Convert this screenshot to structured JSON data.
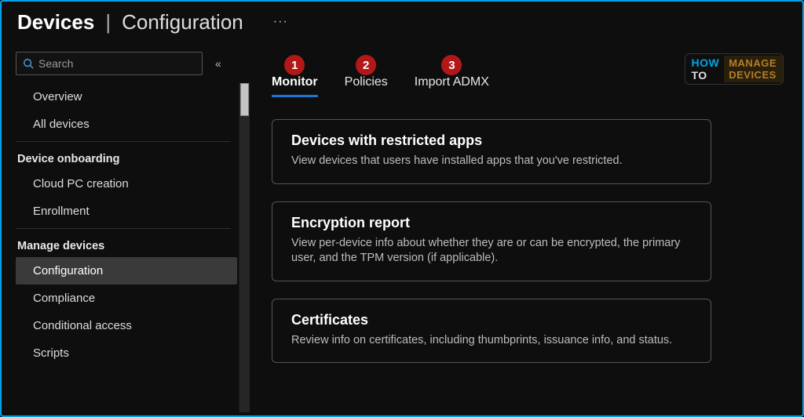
{
  "header": {
    "title_strong": "Devices",
    "title_sep": "|",
    "title_light": "Configuration",
    "more_label": "···"
  },
  "search": {
    "placeholder": "Search"
  },
  "sidebar": {
    "top_items": [
      {
        "label": "Overview"
      },
      {
        "label": "All devices"
      }
    ],
    "groups": [
      {
        "label": "Device onboarding",
        "items": [
          {
            "label": "Cloud PC creation"
          },
          {
            "label": "Enrollment"
          }
        ]
      },
      {
        "label": "Manage devices",
        "items": [
          {
            "label": "Configuration",
            "selected": true
          },
          {
            "label": "Compliance"
          },
          {
            "label": "Conditional access"
          },
          {
            "label": "Scripts"
          }
        ]
      }
    ]
  },
  "tabs": [
    {
      "badge": "1",
      "label": "Monitor",
      "active": true
    },
    {
      "badge": "2",
      "label": "Policies",
      "active": false
    },
    {
      "badge": "3",
      "label": "Import ADMX",
      "active": false
    }
  ],
  "cards": [
    {
      "title": "Devices with restricted apps",
      "desc": "View devices that users have installed apps that you've restricted."
    },
    {
      "title": "Encryption report",
      "desc": "View per-device info about whether they are or can be encrypted, the primary user, and the TPM version (if applicable)."
    },
    {
      "title": "Certificates",
      "desc": "Review info on certificates, including thumbprints, issuance info, and status."
    }
  ],
  "watermark": {
    "left1": "HOW",
    "left2": "TO",
    "right1": "MANAGE",
    "right2": "DEVICES"
  }
}
